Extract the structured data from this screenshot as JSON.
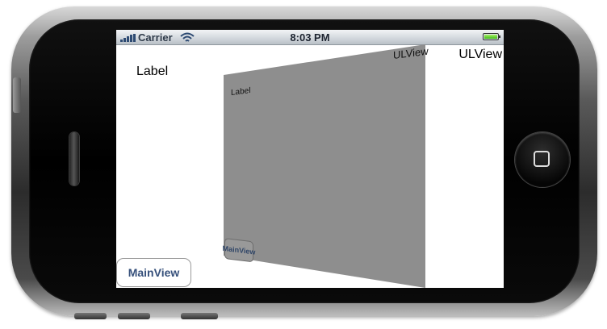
{
  "status_bar": {
    "carrier": "Carrier",
    "time": "8:03 PM",
    "battery_level": 1.0,
    "colors": {
      "signal": "#2e4b73",
      "battery": "#3fbd14"
    }
  },
  "main_view": {
    "label_text": "Label",
    "ulview_label_text": "ULView",
    "button_label": "MainView"
  },
  "ulview_card": {
    "title": "ULView",
    "label_text": "Label",
    "button_label": "MainView",
    "background_color": "#8e8e8e"
  },
  "device": {
    "icons": [
      "home-button-icon",
      "speaker-grille",
      "wifi-icon",
      "signal-bars-icon",
      "battery-icon"
    ]
  }
}
